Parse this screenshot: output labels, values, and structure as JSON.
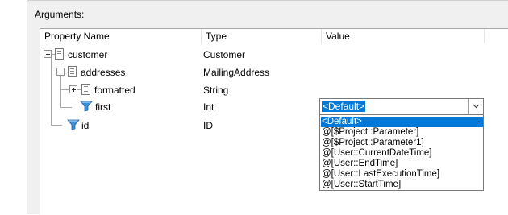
{
  "section": {
    "label": "Arguments:"
  },
  "columns": [
    "Property Name",
    "Type",
    "Value"
  ],
  "rows": [
    {
      "name": "customer",
      "type": "Customer",
      "icon": "document-icon"
    },
    {
      "name": "addresses",
      "type": "MailingAddress",
      "icon": "document-icon"
    },
    {
      "name": "formatted",
      "type": "String",
      "icon": "document-icon"
    },
    {
      "name": "first",
      "type": "Int",
      "icon": "funnel-icon"
    },
    {
      "name": "id",
      "type": "ID",
      "icon": "funnel-icon"
    }
  ],
  "value_combo": {
    "selected": "<Default>",
    "options": [
      "<Default>",
      "@[$Project::Parameter]",
      "@[$Project::Parameter1]",
      "@[User::CurrentDateTime]",
      "@[User::EndTime]",
      "@[User::LastExecutionTime]",
      "@[User::StartTime]"
    ],
    "highlight_color": "#0078d7"
  }
}
